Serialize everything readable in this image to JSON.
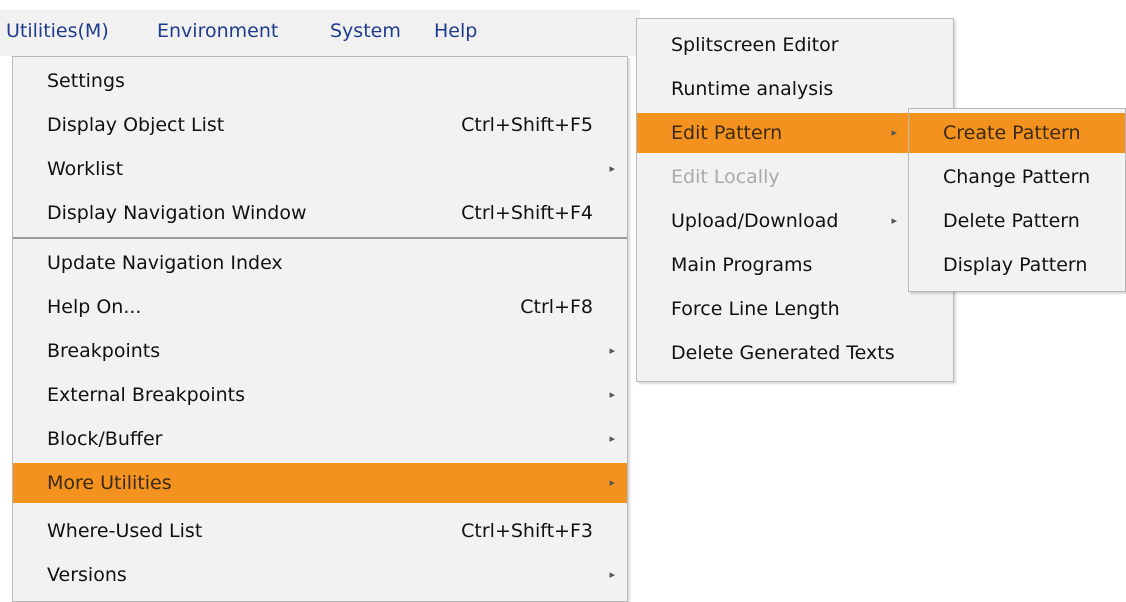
{
  "menubar": [
    {
      "label": "Utilities(M)"
    },
    {
      "label": "Environment"
    },
    {
      "label": "System"
    },
    {
      "label": "Help"
    }
  ],
  "utilities_menu": [
    {
      "label": "Settings",
      "shortcut": "",
      "submenu": false
    },
    {
      "label": "Display Object List",
      "shortcut": "Ctrl+Shift+F5",
      "submenu": false
    },
    {
      "label": "Worklist",
      "shortcut": "",
      "submenu": true
    },
    {
      "label": "Display Navigation Window",
      "shortcut": "Ctrl+Shift+F4",
      "submenu": false
    },
    {
      "label": "Update Navigation Index",
      "shortcut": "",
      "submenu": false
    },
    {
      "label": "Help On...",
      "shortcut": "Ctrl+F8",
      "submenu": false
    },
    {
      "label": "Breakpoints",
      "shortcut": "",
      "submenu": true
    },
    {
      "label": "External Breakpoints",
      "shortcut": "",
      "submenu": true
    },
    {
      "label": "Block/Buffer",
      "shortcut": "",
      "submenu": true
    },
    {
      "label": "More Utilities",
      "shortcut": "",
      "submenu": true,
      "highlighted": true
    },
    {
      "label": "Where-Used List",
      "shortcut": "Ctrl+Shift+F3",
      "submenu": false
    },
    {
      "label": "Versions",
      "shortcut": "",
      "submenu": true
    }
  ],
  "more_utilities_menu": [
    {
      "label": "Splitscreen Editor"
    },
    {
      "label": "Runtime analysis"
    },
    {
      "label": "Edit Pattern",
      "submenu": true,
      "highlighted": true
    },
    {
      "label": "Edit Locally",
      "disabled": true
    },
    {
      "label": "Upload/Download",
      "submenu": true
    },
    {
      "label": "Main Programs"
    },
    {
      "label": "Force Line Length"
    },
    {
      "label": "Delete Generated Texts"
    }
  ],
  "edit_pattern_menu": [
    {
      "label": "Create Pattern",
      "highlighted": true
    },
    {
      "label": "Change Pattern"
    },
    {
      "label": "Delete Pattern"
    },
    {
      "label": "Display Pattern"
    }
  ],
  "colors": {
    "highlight": "#f4921f",
    "menubar_text": "#1f3b8c",
    "menu_bg": "#f2f2f2"
  },
  "icons": {
    "submenu_arrow": "▸"
  }
}
